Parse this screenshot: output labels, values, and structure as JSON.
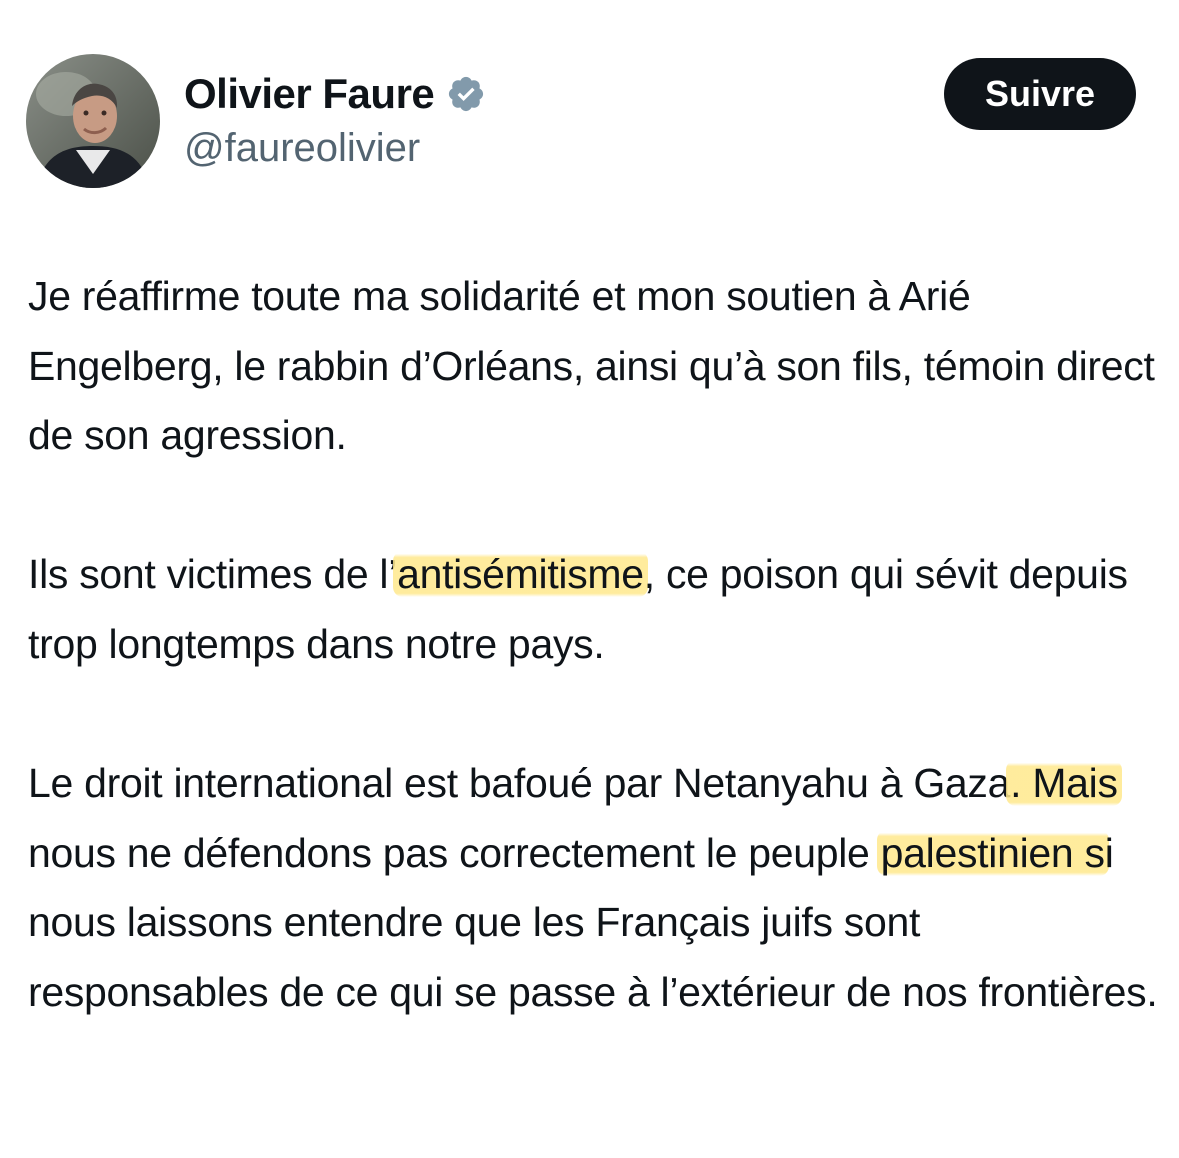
{
  "author": {
    "name": "Olivier Faure",
    "handle": "@faureolivier",
    "verified": true,
    "avatar_icon": "profile-photo",
    "verified_icon": "verified-badge-icon",
    "verified_color": "#829aab"
  },
  "follow_button": {
    "label": "Suivre"
  },
  "tweet": {
    "p1": "Je réaffirme toute ma solidarité et mon soutien à Arié Engelberg, le rabbin d’Orléans, ainsi qu’à son fils, témoin direct de son agression.",
    "p2": {
      "before": "Ils sont victimes de l’",
      "hl1": "antisémitisme",
      "after": ", ce poison qui sévit depuis trop longtemps dans notre pays."
    },
    "p3": {
      "part1": "Le droit international est bafoué par Netanyahu à Gaza",
      "hl1": ". Mais ",
      "part2": "nous ne défendons pas correctement le peuple ",
      "hl2": "palestinien s",
      "part3": "i nous laissons entendre que les Français juifs sont responsables de ce qui se passe à l’extérieur de nos frontières."
    }
  },
  "colors": {
    "text": "#0f1419",
    "secondary_text": "#536471",
    "button_bg": "#0f1419",
    "highlight": "#ffe88c"
  }
}
